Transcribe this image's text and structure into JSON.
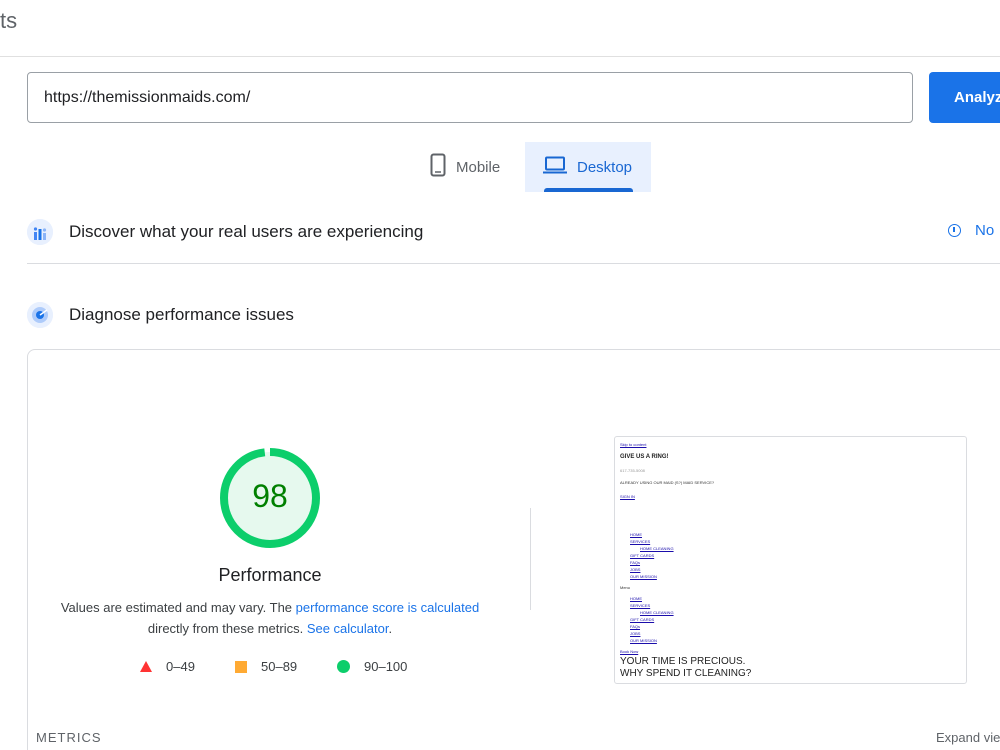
{
  "header": {
    "title": "ts"
  },
  "search": {
    "url_value": "https://themissionmaids.com/",
    "analyze_label": "Analyz"
  },
  "tabs": [
    {
      "label": "Mobile",
      "icon": "phone-icon",
      "selected": false
    },
    {
      "label": "Desktop",
      "icon": "laptop-icon",
      "selected": true
    }
  ],
  "sections": {
    "real_users": {
      "title": "Discover what your real users are experiencing",
      "link_label": "No"
    },
    "diagnose": {
      "title": "Diagnose performance issues"
    }
  },
  "performance": {
    "score": "98",
    "score_fraction": 0.98,
    "label": "Performance",
    "desc_prefix": "Values are estimated and may vary. The ",
    "desc_link": "performance score is calculated",
    "desc_middle": "directly from these metrics. ",
    "desc_link2": "See calculator",
    "desc_suffix": "."
  },
  "legend": [
    {
      "label": "0–49",
      "shape": "triangle",
      "color": "#ff3333"
    },
    {
      "label": "50–89",
      "shape": "square",
      "color": "#ffaa33"
    },
    {
      "label": "90–100",
      "shape": "circle",
      "color": "#0cce6b"
    }
  ],
  "page_preview": {
    "skip": "Skip to content",
    "give_ring": "GIVE US A RING!",
    "phone": "617-735-5008",
    "already": "ALREADY USING OUR MAID (S?) MAID SERVICE?",
    "sign_in": "SIGN IN",
    "nav": [
      "HOME",
      "SERVICES",
      "HOME CLEANING",
      "GIFT CARDS",
      "FAQs",
      "JOBS",
      "OUR MISSION"
    ],
    "menu": "Menu",
    "nav2": [
      "HOME",
      "SERVICES",
      "HOME CLEANING",
      "GIFT CARDS",
      "FAQs",
      "JOBS",
      "OUR MISSION"
    ],
    "book": "Book Now",
    "headline1": "YOUR TIME IS PRECIOUS.",
    "headline2": "WHY SPEND IT CLEANING?"
  },
  "footer": {
    "metrics_label": "METRICS",
    "expand_label": "Expand vie"
  },
  "colors": {
    "accent": "#1a73e8",
    "good": "#0cce6b",
    "good_text": "#008000",
    "tab_bg": "#e8f0fe"
  }
}
